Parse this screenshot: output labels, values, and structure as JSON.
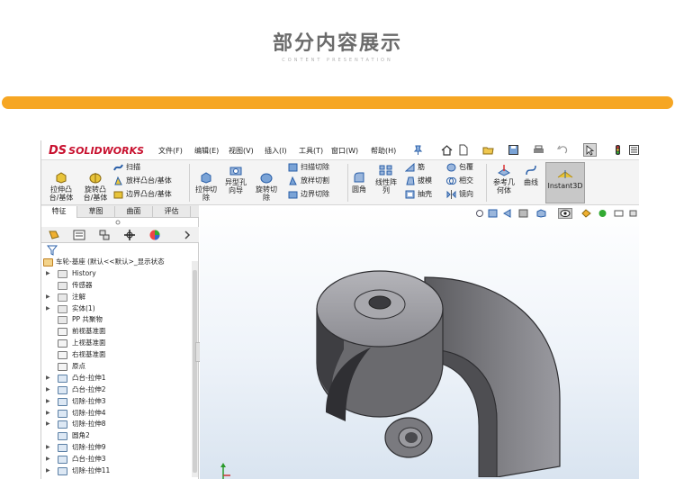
{
  "header": {
    "title": "部分内容展示",
    "subtitle": "CONTENT PRESENTATION"
  },
  "app": {
    "logo_prefix": "DS",
    "logo_text": "SOLIDWORKS",
    "menu": [
      "文件(F)",
      "编辑(E)",
      "视图(V)",
      "插入(I)",
      "工具(T)",
      "窗口(W)",
      "帮助(H)"
    ],
    "ribbon": {
      "extrude_boss": "拉伸凸\n台/基体",
      "revolve_boss": "旋转凸\n台/基体",
      "sweep": "扫描",
      "loft": "放样凸台/基体",
      "boundary": "边界凸台/基体",
      "extrude_cut": "拉伸切\n除",
      "hole_wizard": "异型孔\n向导",
      "revolve_cut": "旋转切\n除",
      "sweep_cut": "扫描切除",
      "loft_cut": "放样切割",
      "boundary_cut": "边界切除",
      "fillet": "圆角",
      "linear_pattern": "线性阵\n列",
      "rib": "筋",
      "draft": "拔模",
      "shell": "抽壳",
      "wrap": "包覆",
      "intersect": "相交",
      "mirror": "镜向",
      "reference_geometry": "参考几\n何体",
      "curves": "曲线",
      "instant3d": "Instant3D"
    },
    "tabs": [
      "特征",
      "草图",
      "曲面",
      "评估"
    ],
    "active_tab": 0,
    "tree": {
      "root": "车轮-基座 (默认<<默认>_显示状态",
      "items": [
        {
          "label": "History",
          "icon": "history-icon",
          "arrow": true
        },
        {
          "label": "传感器",
          "icon": "sensor-icon",
          "arrow": false
        },
        {
          "label": "注解",
          "icon": "annotation-icon",
          "arrow": true
        },
        {
          "label": "实体(1)",
          "icon": "solid-body-icon",
          "arrow": true
        },
        {
          "label": "PP 共聚物",
          "icon": "material-icon",
          "arrow": false
        },
        {
          "label": "前视基准面",
          "icon": "plane-icon",
          "arrow": false
        },
        {
          "label": "上视基准面",
          "icon": "plane-icon",
          "arrow": false
        },
        {
          "label": "右视基准面",
          "icon": "plane-icon",
          "arrow": false
        },
        {
          "label": "原点",
          "icon": "origin-icon",
          "arrow": false
        },
        {
          "label": "凸台-拉伸1",
          "icon": "extrude-icon",
          "arrow": true
        },
        {
          "label": "凸台-拉伸2",
          "icon": "extrude-icon",
          "arrow": true
        },
        {
          "label": "切除-拉伸3",
          "icon": "cut-icon",
          "arrow": true
        },
        {
          "label": "切除-拉伸4",
          "icon": "cut-icon",
          "arrow": true
        },
        {
          "label": "切除-拉伸8",
          "icon": "cut-icon",
          "arrow": true
        },
        {
          "label": "圆角2",
          "icon": "fillet-icon",
          "arrow": false
        },
        {
          "label": "切除-拉伸9",
          "icon": "cut-icon",
          "arrow": true
        },
        {
          "label": "凸台-拉伸3",
          "icon": "extrude-icon",
          "arrow": true
        },
        {
          "label": "切除-拉伸11",
          "icon": "cut-icon",
          "arrow": true
        }
      ]
    }
  },
  "colors": {
    "accent_bar": "#f6a623",
    "brand_red": "#c8102e",
    "model_gray": "#6e6e72"
  }
}
